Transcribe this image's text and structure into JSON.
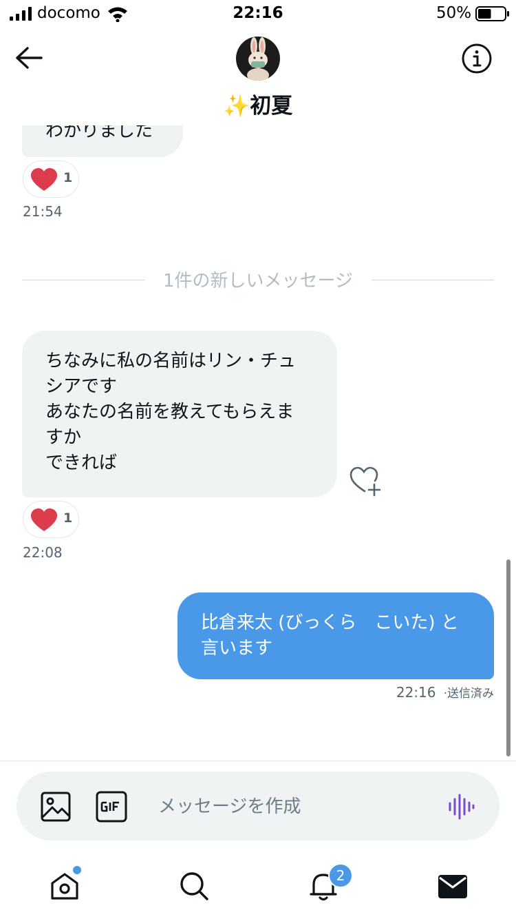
{
  "status_bar": {
    "carrier": "docomo",
    "time": "22:16",
    "battery": "50%",
    "battery_level": 0.5
  },
  "header": {
    "contact_name": "✨初夏",
    "avatar_icon": "rabbit-avatar"
  },
  "messages": [
    {
      "direction": "incoming",
      "text_lines": [
        "わかりました"
      ],
      "reaction": {
        "emoji": "heart",
        "count": "1"
      },
      "time": "21:54"
    },
    {
      "type": "divider",
      "label": "1件の新しいメッセージ"
    },
    {
      "direction": "incoming",
      "text_lines": [
        "ちなみに私の名前はリン・チュ",
        "シアです",
        "あなたの名前を教えてもらえま",
        "すか",
        "できれば"
      ],
      "reaction": {
        "emoji": "heart",
        "count": "1"
      },
      "time": "22:08"
    },
    {
      "direction": "outgoing",
      "text_lines": [
        "比倉来太 (びっくら　こいた) と",
        "言います"
      ],
      "time": "22:16",
      "status": "·送信済み"
    }
  ],
  "composer": {
    "placeholder": "メッセージを作成",
    "value": ""
  },
  "tabbar": {
    "notifications_badge": "2"
  },
  "colors": {
    "accent": "#4a99e9",
    "incoming_bubble": "#eff3f4",
    "heart": "#e0245e",
    "voice_icon": "#794bc4"
  }
}
